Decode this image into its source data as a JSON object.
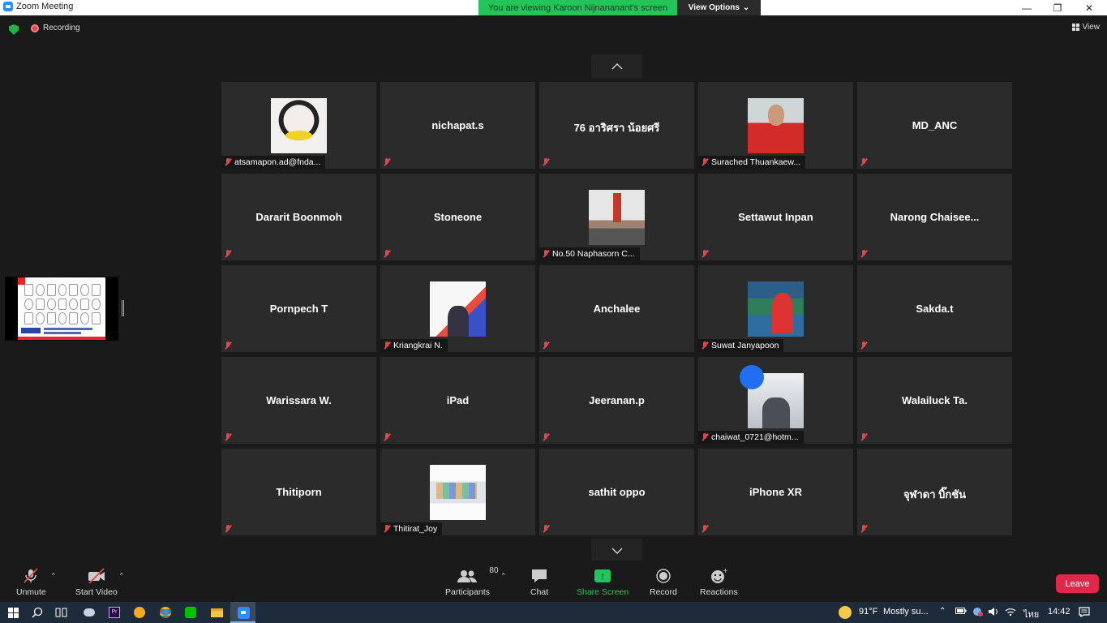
{
  "window": {
    "title": "Zoom Meeting"
  },
  "banner": {
    "viewing_text": "You are viewing Karoon Nijnananant's screen",
    "view_options": "View Options"
  },
  "topbar": {
    "recording_label": "Recording",
    "view_label": "View"
  },
  "tiles": [
    {
      "name": "atsamapon.ad@fnda...",
      "video": true
    },
    {
      "name": "nichapat.s",
      "video": false
    },
    {
      "name": "76 อาริศรา น้อยศรี",
      "video": false
    },
    {
      "name": "Surached Thuankaew...",
      "video": true
    },
    {
      "name": "MD_ANC",
      "video": false
    },
    {
      "name": "Dararit Boonmoh",
      "video": false
    },
    {
      "name": "Stoneone",
      "video": false
    },
    {
      "name": "No.50 Naphasorn C...",
      "video": true
    },
    {
      "name": "Settawut Inpan",
      "video": false
    },
    {
      "name": "Narong  Chaisee...",
      "video": false
    },
    {
      "name": "Pornpech T",
      "video": false
    },
    {
      "name": "Kriangkrai N.",
      "video": true
    },
    {
      "name": "Anchalee",
      "video": false
    },
    {
      "name": "Suwat Janyapoon",
      "video": true
    },
    {
      "name": "Sakda.t",
      "video": false
    },
    {
      "name": "Warissara W.",
      "video": false
    },
    {
      "name": "iPad",
      "video": false
    },
    {
      "name": "Jeeranan.p",
      "video": false
    },
    {
      "name": "chaiwat_0721@hotm...",
      "video": true
    },
    {
      "name": "Walailuck Ta.",
      "video": false
    },
    {
      "name": "Thitiporn",
      "video": false
    },
    {
      "name": "Thitirat_Joy",
      "video": true
    },
    {
      "name": "sathit oppo",
      "video": false
    },
    {
      "name": "iPhone XR",
      "video": false
    },
    {
      "name": "จุฬาดา บิ๊กชัน",
      "video": false
    }
  ],
  "toolbar": {
    "unmute": "Unmute",
    "start_video": "Start Video",
    "participants": "Participants",
    "participants_count": "80",
    "chat": "Chat",
    "share_screen": "Share Screen",
    "record": "Record",
    "reactions": "Reactions",
    "leave": "Leave"
  },
  "taskbar": {
    "weather_temp": "91°F",
    "weather_text": "Mostly su...",
    "language": "ไทย",
    "time": "14:42"
  },
  "colors": {
    "accent_green": "#23c45a",
    "mute_red": "#e0464b",
    "leave_red": "#e0284a",
    "taskbar": "#1d2b3a"
  }
}
